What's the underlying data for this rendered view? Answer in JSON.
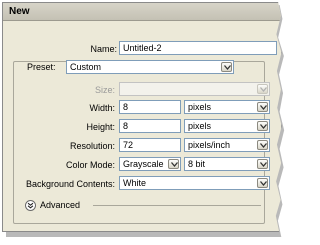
{
  "window": {
    "title": "New"
  },
  "form": {
    "name": {
      "label": "Name:",
      "value": "Untitled-2"
    },
    "preset": {
      "label": "Preset:",
      "value": "Custom"
    },
    "size": {
      "label": "Size:",
      "value": ""
    },
    "width": {
      "label": "Width:",
      "value": "8",
      "unit": "pixels"
    },
    "height": {
      "label": "Height:",
      "value": "8",
      "unit": "pixels"
    },
    "resolution": {
      "label": "Resolution:",
      "value": "72",
      "unit": "pixels/inch"
    },
    "color_mode": {
      "label": "Color Mode:",
      "value": "Grayscale",
      "depth": "8 bit"
    },
    "background": {
      "label": "Background Contents:",
      "value": "White"
    },
    "advanced": {
      "label": "Advanced"
    }
  },
  "icons": {
    "dropdown": "chevron-down-icon",
    "expand": "expand-circle-icon"
  }
}
